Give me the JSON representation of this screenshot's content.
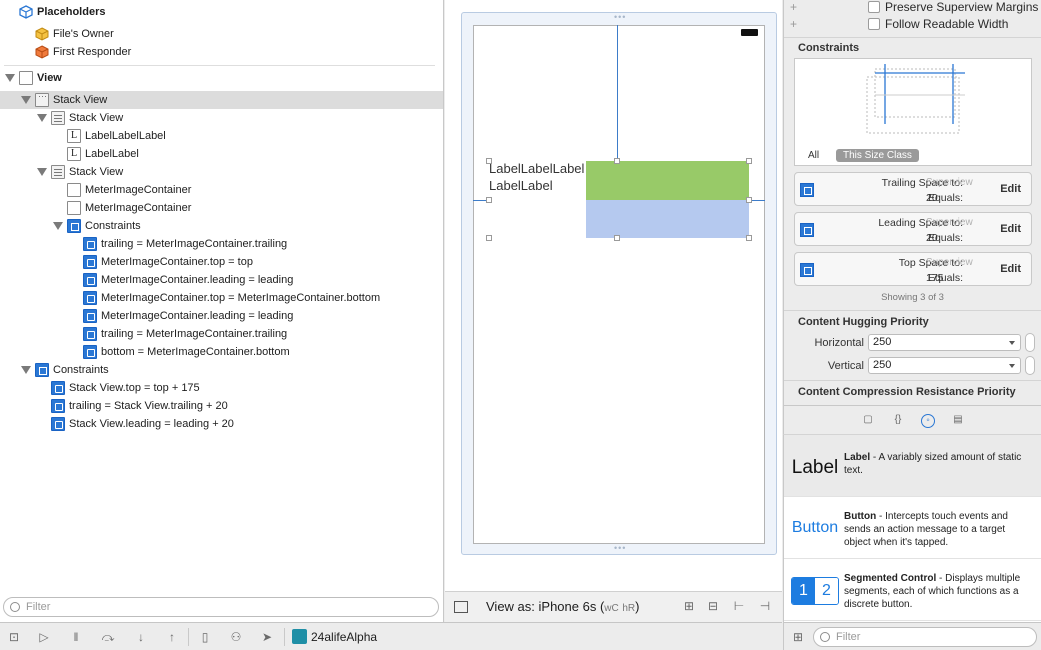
{
  "outline": {
    "placeholders_label": "Placeholders",
    "files_owner": "File's Owner",
    "first_responder": "First Responder",
    "view": "View",
    "stack_view": "Stack View",
    "inner_stack_1": "Stack View",
    "label_1": "LabelLabelLabel",
    "label_2": "LabelLabel",
    "inner_stack_2": "Stack View",
    "meter_1": "MeterImageContainer",
    "meter_2": "MeterImageContainer",
    "inner_constraints": "Constraints",
    "inner_constraint_items": [
      "trailing = MeterImageContainer.trailing",
      "MeterImageContainer.top = top",
      "MeterImageContainer.leading = leading",
      "MeterImageContainer.top = MeterImageContainer.bottom",
      "MeterImageContainer.leading = leading",
      "trailing = MeterImageContainer.trailing",
      "bottom = MeterImageContainer.bottom"
    ],
    "outer_constraints": "Constraints",
    "outer_constraint_items": [
      "Stack View.top = top + 175",
      "trailing = Stack View.trailing + 20",
      "Stack View.leading = leading + 20"
    ],
    "filter_placeholder": "Filter"
  },
  "canvas": {
    "label_line_1": "LabelLabelLabel",
    "label_line_2": "LabelLabel",
    "view_as": "View as: iPhone 6s (",
    "size_class_w": "wC",
    "size_class_h": "hR",
    "view_as_close": ")"
  },
  "inspector": {
    "preserve_margins": "Preserve Superview Margins",
    "follow_readable": "Follow Readable Width",
    "constraints_title": "Constraints",
    "tab_all": "All",
    "tab_size_class": "This Size Class",
    "constraints": [
      {
        "label": "Trailing Space to:",
        "target": "Superview",
        "equals_label": "Equals:",
        "value": "20",
        "edit": "Edit"
      },
      {
        "label": "Leading Space to:",
        "target": "Superview",
        "equals_label": "Equals:",
        "value": "20",
        "edit": "Edit"
      },
      {
        "label": "Top Space to:",
        "target": "Superview",
        "equals_label": "Equals:",
        "value": "175",
        "edit": "Edit"
      }
    ],
    "showing": "Showing 3 of 3",
    "hugging_title": "Content Hugging Priority",
    "horizontal_label": "Horizontal",
    "horizontal_value": "250",
    "vertical_label": "Vertical",
    "vertical_value": "250",
    "compression_title": "Content Compression Resistance Priority"
  },
  "library": {
    "items": [
      {
        "preview": "Label",
        "name": "Label",
        "desc": " - A variably sized amount of static text."
      },
      {
        "preview": "Button",
        "name": "Button",
        "desc": " - Intercepts touch events and sends an action message to a target object when it's tapped."
      },
      {
        "seg_1": "1",
        "seg_2": "2",
        "name": "Segmented Control",
        "desc": " - Displays multiple segments, each of which functions as a discrete button."
      }
    ],
    "filter_placeholder": "Filter"
  },
  "bottom": {
    "target": "24alifeAlpha"
  },
  "colors": {
    "accent": "#2a77d4",
    "green_view": "#98ca68",
    "blue_view": "#b5c9ef"
  }
}
